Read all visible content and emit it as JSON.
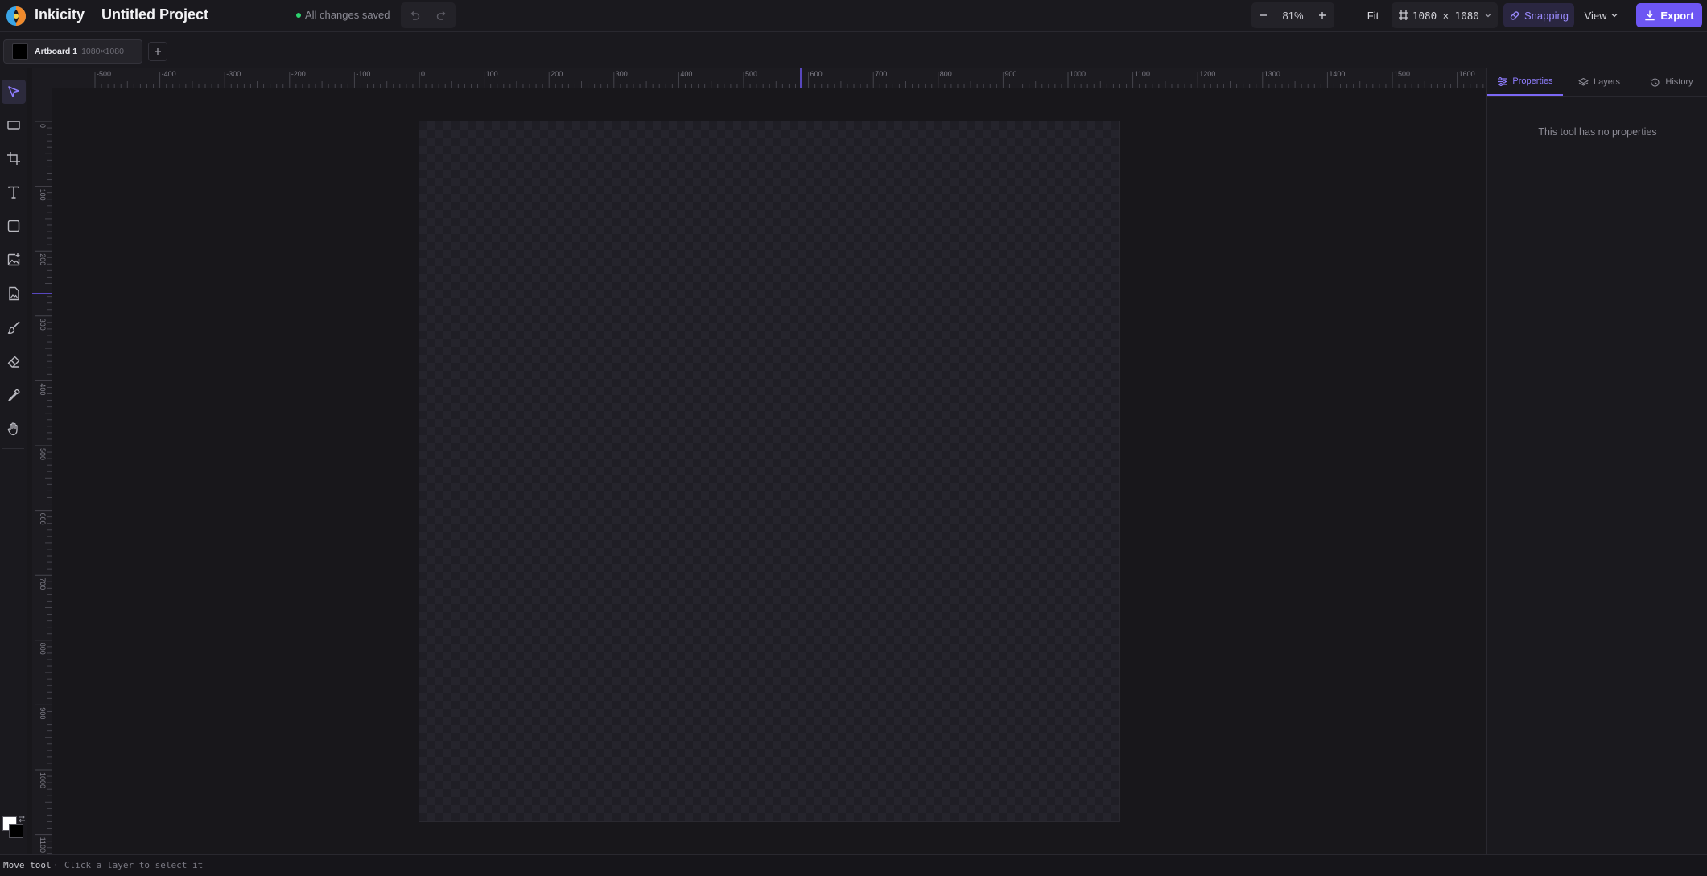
{
  "app": {
    "name": "Inkicity",
    "project_title": "Untitled Project",
    "save_status": "All changes saved"
  },
  "zoom": {
    "value": "81%",
    "fit_label": "Fit"
  },
  "canvas_size": {
    "label": "1080 × 1080"
  },
  "snapping": {
    "label": "Snapping",
    "enabled": true
  },
  "view": {
    "label": "View"
  },
  "export": {
    "label": "Export"
  },
  "artboards": [
    {
      "name": "Artboard 1",
      "dims": "1080×1080",
      "fill_color": "#000000"
    }
  ],
  "tools": [
    {
      "name": "move-tool",
      "icon": "cursor-arrow-icon",
      "active": true
    },
    {
      "name": "marquee-tool",
      "icon": "rectangle-select-icon"
    },
    {
      "name": "crop-tool",
      "icon": "crop-icon"
    },
    {
      "name": "text-tool",
      "icon": "text-t-icon"
    },
    {
      "name": "shape-tool",
      "icon": "square-icon"
    },
    {
      "name": "image-tool",
      "icon": "image-plus-icon"
    },
    {
      "name": "import-tool",
      "icon": "file-image-icon"
    },
    {
      "name": "brush-tool",
      "icon": "paintbrush-icon"
    },
    {
      "name": "eraser-tool",
      "icon": "eraser-icon"
    },
    {
      "name": "eyedropper-tool",
      "icon": "eyedropper-icon"
    },
    {
      "name": "hand-tool",
      "icon": "hand-icon"
    }
  ],
  "ruler": {
    "top_labels": [
      "-500",
      "-400",
      "-300",
      "-200",
      "-100",
      "0",
      "100",
      "200",
      "300",
      "400",
      "500",
      "600",
      "700",
      "800",
      "900",
      "1000",
      "1100",
      "1200",
      "1300",
      "1400",
      "1500",
      "1600"
    ],
    "left_labels": [
      "0",
      "100",
      "200",
      "300",
      "400",
      "500",
      "600",
      "700",
      "800",
      "900",
      "1000",
      "1100"
    ]
  },
  "right_panel": {
    "tabs": [
      {
        "label": "Properties",
        "icon": "sliders-icon",
        "active": true
      },
      {
        "label": "Layers",
        "icon": "layers-icon"
      },
      {
        "label": "History",
        "icon": "history-icon"
      }
    ],
    "empty_message": "This tool has no properties"
  },
  "colors": {
    "foreground": "#ffffff",
    "background": "#000000",
    "accent": "#6d56f3"
  },
  "status": {
    "tool": "Move tool",
    "separator": "·",
    "hint": "Click a layer to select it"
  }
}
